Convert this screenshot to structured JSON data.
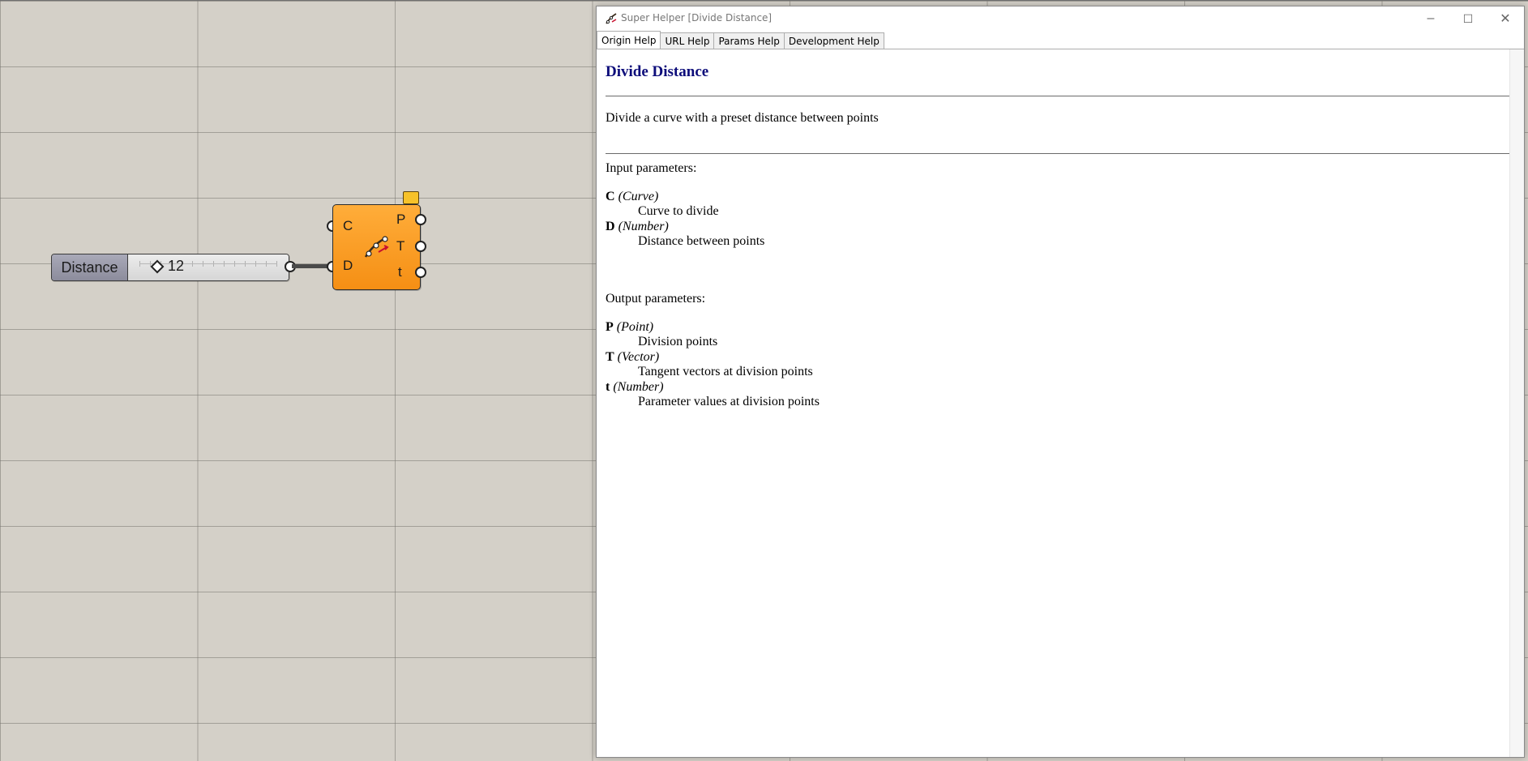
{
  "canvas": {
    "slider": {
      "label": "Distance",
      "value": "12"
    },
    "component": {
      "inputs": [
        "C",
        "D"
      ],
      "outputs": [
        "P",
        "T",
        "t"
      ]
    }
  },
  "window": {
    "title": "Super Helper [Divide Distance]",
    "tabs": [
      {
        "label": "Origin Help",
        "active": true
      },
      {
        "label": "URL Help",
        "active": false
      },
      {
        "label": "Params Help",
        "active": false
      },
      {
        "label": "Development Help",
        "active": false
      }
    ],
    "controls": {
      "minimize": "–",
      "maximize": "☐",
      "close": "✕"
    }
  },
  "help": {
    "title": "Divide Distance",
    "description": "Divide a curve with a preset distance between points",
    "inputs_heading": "Input parameters:",
    "inputs": [
      {
        "code": "C",
        "type": "(Curve)",
        "desc": "Curve to divide"
      },
      {
        "code": "D",
        "type": "(Number)",
        "desc": "Distance between points"
      }
    ],
    "outputs_heading": "Output parameters:",
    "outputs": [
      {
        "code": "P",
        "type": "(Point)",
        "desc": "Division points"
      },
      {
        "code": "T",
        "type": "(Vector)",
        "desc": "Tangent vectors at division points"
      },
      {
        "code": "t",
        "type": "(Number)",
        "desc": "Parameter values at division points"
      }
    ]
  },
  "colors": {
    "canvas_bg": "#d4d0c8",
    "component_orange": "#f89a20",
    "help_title": "#0d0d7a"
  }
}
